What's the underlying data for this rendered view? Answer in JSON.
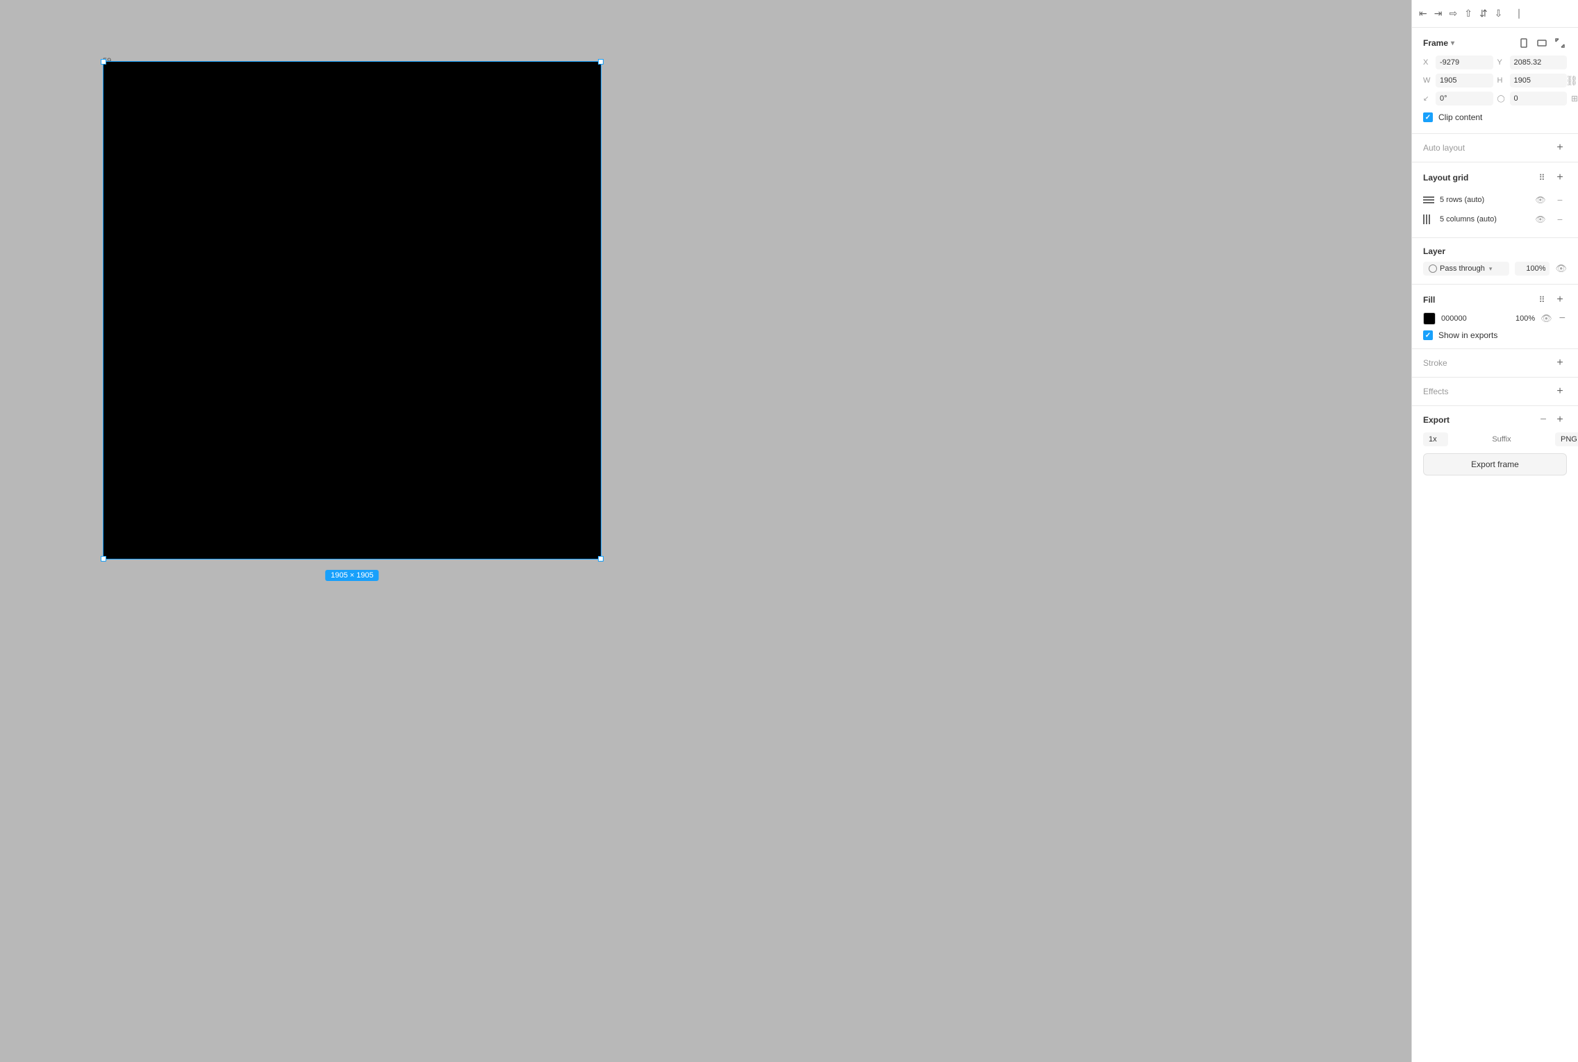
{
  "toolbar": {
    "icons": [
      "align-left",
      "align-center-h",
      "align-right",
      "align-top",
      "align-center-v",
      "align-bottom",
      "distribute"
    ]
  },
  "canvas": {
    "frame_label": "59",
    "size_badge": "1905 × 1905"
  },
  "panel": {
    "frame_section": {
      "title": "Frame",
      "x_label": "X",
      "x_value": "-9279",
      "y_label": "Y",
      "y_value": "2085.32",
      "w_label": "W",
      "w_value": "1905",
      "h_label": "H",
      "h_value": "1905",
      "rotation_value": "0°",
      "corner_radius_value": "0",
      "clip_content_label": "Clip content"
    },
    "auto_layout": {
      "title": "Auto layout"
    },
    "layout_grid": {
      "title": "Layout grid",
      "rows_label": "5 rows (auto)",
      "cols_label": "5 columns (auto)"
    },
    "layer": {
      "title": "Layer",
      "blend_mode": "Pass through",
      "opacity": "100%"
    },
    "fill": {
      "title": "Fill",
      "hex": "000000",
      "opacity": "100%",
      "show_in_exports_label": "Show in exports"
    },
    "stroke": {
      "title": "Stroke"
    },
    "effects": {
      "title": "Effects"
    },
    "export": {
      "title": "Export",
      "scale": "1x",
      "suffix_placeholder": "Suffix",
      "format": "PNG",
      "export_btn_label": "Export frame"
    }
  }
}
